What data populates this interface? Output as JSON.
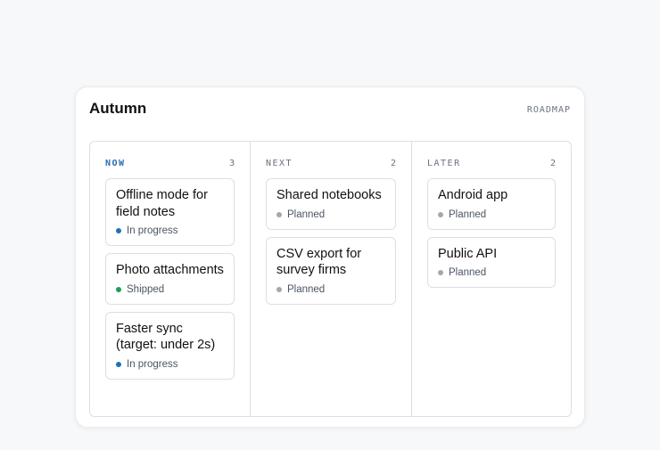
{
  "header": {
    "title": "Autumn",
    "tag": "ROADMAP"
  },
  "colors": {
    "in_progress": "#1f6fbf",
    "shipped": "#1e9e5a",
    "planned": "#a3a8b0",
    "accent": "#2b6cb0"
  },
  "columns": [
    {
      "name": "NOW",
      "count": "3",
      "items": [
        {
          "title": "Offline mode for field notes",
          "status": "In progress",
          "status_key": "in_progress"
        },
        {
          "title": "Photo attachments",
          "status": "Shipped",
          "status_key": "shipped"
        },
        {
          "title": "Faster sync (target: under 2s)",
          "status": "In progress",
          "status_key": "in_progress"
        }
      ]
    },
    {
      "name": "NEXT",
      "count": "2",
      "items": [
        {
          "title": "Shared notebooks",
          "status": "Planned",
          "status_key": "planned"
        },
        {
          "title": "CSV export for survey firms",
          "status": "Planned",
          "status_key": "planned"
        }
      ]
    },
    {
      "name": "LATER",
      "count": "2",
      "items": [
        {
          "title": "Android app",
          "status": "Planned",
          "status_key": "planned"
        },
        {
          "title": "Public API",
          "status": "Planned",
          "status_key": "planned"
        }
      ]
    }
  ]
}
